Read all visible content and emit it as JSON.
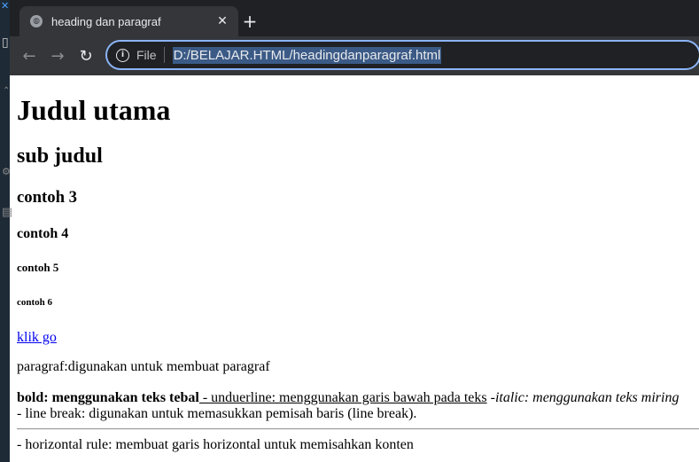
{
  "browser": {
    "tab_title": "heading dan paragraf",
    "tab_close_icon": "✕",
    "new_tab_icon": "+",
    "back_icon": "←",
    "forward_icon": "→",
    "reload_icon": "↻",
    "info_icon": "i",
    "file_label": "File",
    "url": "D:/BELAJAR.HTML/headingdanparagraf.html"
  },
  "editor": {
    "close_glyph": "✕"
  },
  "page": {
    "h1": "Judul utama",
    "h2": "sub judul",
    "h3": "contoh 3",
    "h4": "contoh 4",
    "h5": "contoh 5",
    "h6": "contoh 6",
    "link": "klik go",
    "paragraph": "paragraf:digunakan untuk membuat paragraf",
    "bold_text": "bold: menggunakan teks tebal",
    "underline_text": " - unduerline: menggunakan garis bawah pada teks",
    "italic_text": "-italic: menggunakan teks miring",
    "line_break_text": "- line break: digunakan untuk memasukkan pemisah baris (line break).",
    "hr_text": "- horizontal rule: membuat garis horizontal untuk memisahkan konten"
  },
  "colors": {
    "chrome_bg": "#202124",
    "toolbar_bg": "#35363a",
    "omnibox_focus": "#8ab4f8",
    "link": "#0000ee"
  }
}
